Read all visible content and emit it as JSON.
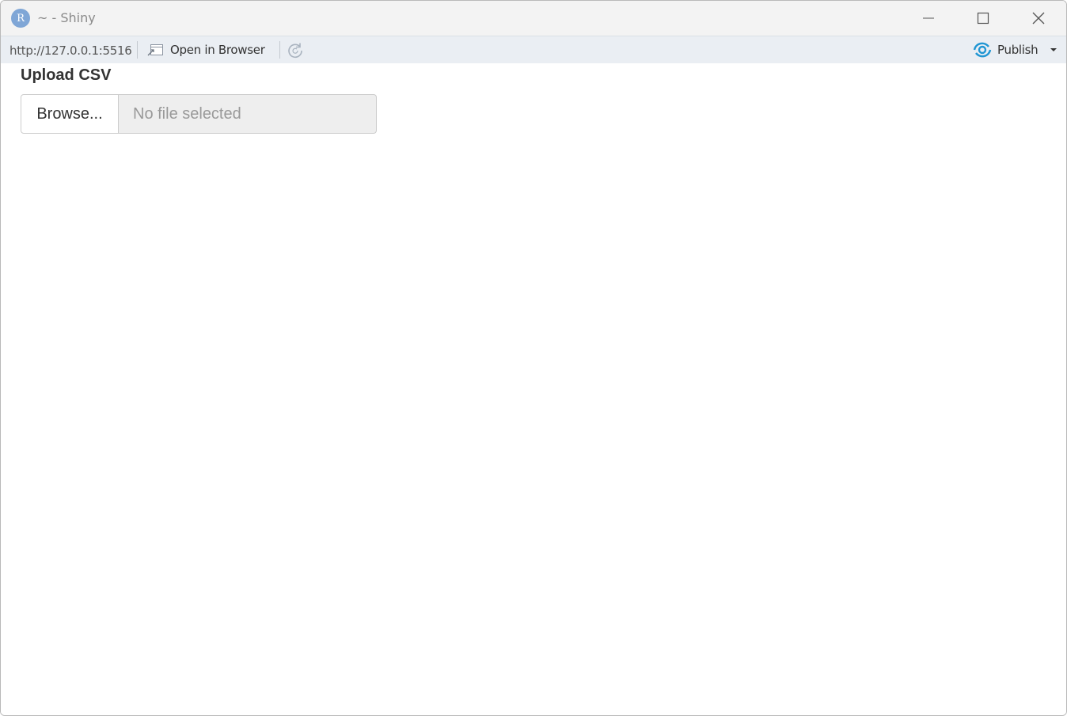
{
  "window": {
    "app_icon_letter": "R",
    "title": "~ - Shiny",
    "controls": {
      "minimize_icon": "minimize-icon",
      "maximize_icon": "maximize-icon",
      "close_icon": "close-icon"
    }
  },
  "toolbar": {
    "url": "http://127.0.0.1:5516",
    "open_in_browser_label": "Open in Browser",
    "open_in_browser_icon": "open-in-browser-icon",
    "refresh_icon": "refresh-icon",
    "publish_label": "Publish",
    "publish_icon": "publish-icon",
    "publish_menu_icon": "caret-down-icon"
  },
  "app": {
    "upload_label": "Upload CSV",
    "browse_button_label": "Browse...",
    "file_status": "No file selected"
  },
  "colors": {
    "app_icon_bg": "#7fa6d6",
    "publish_accent": "#2196d3",
    "toolbar_bg": "#eaeef3",
    "titlebar_bg": "#f3f3f3"
  }
}
